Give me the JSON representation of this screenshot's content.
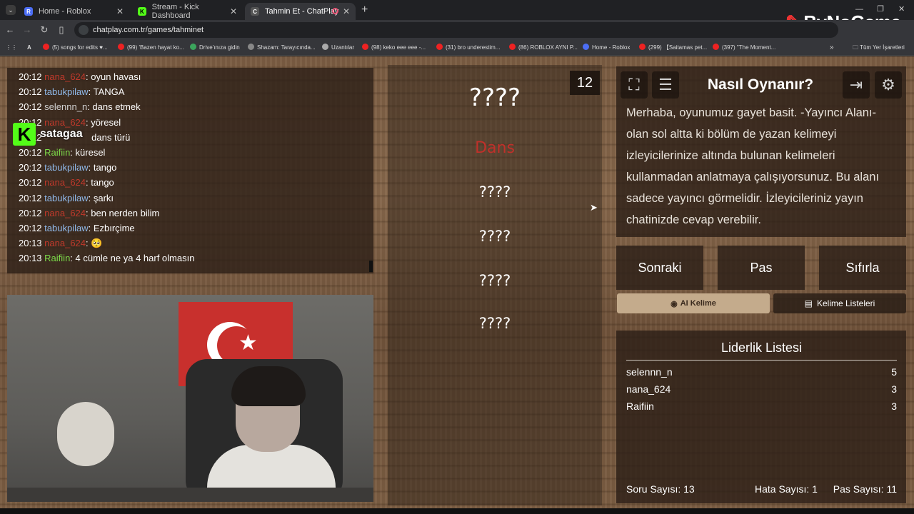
{
  "browser": {
    "tabs": [
      {
        "title": "Home - Roblox",
        "icon": "roblox-icon"
      },
      {
        "title": "Stream - Kick Dashboard",
        "icon": "kick-icon"
      },
      {
        "title": "Tahmin Et - ChatPlay",
        "icon": "chatplay-icon"
      }
    ],
    "url": "chatplay.com.tr/games/tahminet",
    "bookmarks": [
      "(5) songs for edits ♥...",
      "(99) 'Bazen hayat ko...",
      "Drive'ınıza gidin",
      "Shazam: Tarayıcında...",
      "Uzantılar",
      "(98) keko eee eee -...",
      "(31) bro underestim...",
      "(86) ROBLOX AYNI P...",
      "Home - Roblox",
      "(299) 【Saitamas pet...",
      "(397) \"The Moment..."
    ],
    "bookmarks_folder": "Tüm Yer İşaretleri"
  },
  "watermark": "ByNoGame",
  "stream_overlay": {
    "platform": "K",
    "name": "satagaa"
  },
  "chat": [
    {
      "time": "20:12",
      "user": "nana_624",
      "color": "red",
      "text": "oyun havası"
    },
    {
      "time": "20:12",
      "user": "tabukpilaw",
      "color": "blue",
      "text": "TANGA"
    },
    {
      "time": "20:12",
      "user": "selennn_n",
      "color": "gray",
      "text": "dans etmek"
    },
    {
      "time": "20:12",
      "user": "nana_624",
      "color": "red",
      "text": "yöresel"
    },
    {
      "time": "20:12",
      "user": "",
      "color": "gray",
      "text": "dans türü"
    },
    {
      "time": "20:12",
      "user": "Raifiin",
      "color": "green",
      "text": "küresel"
    },
    {
      "time": "20:12",
      "user": "tabukpilaw",
      "color": "blue",
      "text": "tango"
    },
    {
      "time": "20:12",
      "user": "nana_624",
      "color": "red",
      "text": "tango"
    },
    {
      "time": "20:12",
      "user": "tabukpilaw",
      "color": "blue",
      "text": "şarkı"
    },
    {
      "time": "20:12",
      "user": "nana_624",
      "color": "red",
      "text": "ben nerden bilim"
    },
    {
      "time": "20:12",
      "user": "tabukpilaw",
      "color": "blue",
      "text": "Ezbırçime"
    },
    {
      "time": "20:13",
      "user": "nana_624",
      "color": "red",
      "text": "🥺"
    },
    {
      "time": "20:13",
      "user": "Raifiin",
      "color": "green",
      "text": "4 cümle ne ya 4 harf olmasın"
    }
  ],
  "game": {
    "timer": "12",
    "main_word": "????",
    "hint_word": "Dans",
    "hidden_words": [
      "????",
      "????",
      "????",
      "????"
    ],
    "hint_color": "#c0302a"
  },
  "how_to": {
    "title": "Nasıl Oynanır?",
    "text": "Merhaba, oyunumuz gayet basit. -Yayıncı Alanı- olan sol altta ki bölüm de yazan kelimeyi izleyicilerinize altında bulunan kelimeleri kullanmadan anlatmaya çalışıyorsunuz. Bu alanı sadece yayıncı görmelidir. İzleyicileriniz yayın chatinizde cevap verebilir."
  },
  "controls": {
    "next": "Sonraki",
    "pass": "Pas",
    "reset": "Sıfırla",
    "ai_word": "AI Kelime",
    "word_lists": "Kelime Listeleri"
  },
  "leaderboard": {
    "title": "Liderlik Listesi",
    "rows": [
      {
        "name": "selennn_n",
        "score": "5"
      },
      {
        "name": "nana_624",
        "score": "3"
      },
      {
        "name": "Raifiin",
        "score": "3"
      }
    ]
  },
  "stats": {
    "questions": "Soru Sayısı: 13",
    "errors": "Hata Sayısı: 1",
    "passes": "Pas Sayısı: 11"
  }
}
